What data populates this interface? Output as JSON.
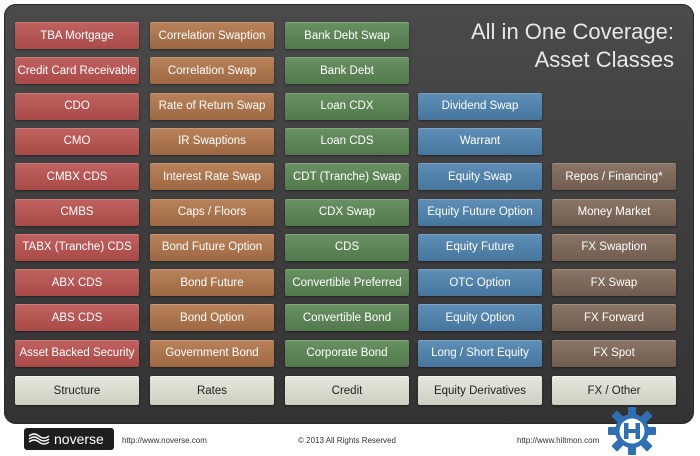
{
  "title": {
    "line1": "All in One Coverage:",
    "line2": "Asset Classes"
  },
  "columns": [
    {
      "key": "structure",
      "label": "Structure",
      "items": [
        "TBA Mortgage",
        "Credit Card Receivable",
        "CDO",
        "CMO",
        "CMBX CDS",
        "CMBS",
        "TABX (Tranche) CDS",
        "ABX CDS",
        "ABS CDS",
        "Asset Backed Security"
      ]
    },
    {
      "key": "rates",
      "label": "Rates",
      "items": [
        "Correlation Swaption",
        "Correlation Swap",
        "Rate of Return Swap",
        "IR Swaptions",
        "Interest Rate Swap",
        "Caps / Floors",
        "Bond Future Option",
        "Bond Future",
        "Bond Option",
        "Government Bond"
      ]
    },
    {
      "key": "credit",
      "label": "Credit",
      "items": [
        "Bank Debt Swap",
        "Bank Debt",
        "Loan CDX",
        "Loan CDS",
        "CDT (Tranche) Swap",
        "CDX Swap",
        "CDS",
        "Convertible Preferred",
        "Convertible Bond",
        "Corporate Bond"
      ]
    },
    {
      "key": "equity",
      "label": "Equity Derivatives",
      "items": [
        "Dividend Swap",
        "Warrant",
        "Equity Swap",
        "Equity Future Option",
        "Equity Future",
        "OTC Option",
        "Equity Option",
        "Long / Short Equity"
      ]
    },
    {
      "key": "fx",
      "label": "FX / Other",
      "items": [
        "Repos / Financing*",
        "Money Market",
        "FX Swaption",
        "FX Swap",
        "FX Forward",
        "FX Spot"
      ]
    }
  ],
  "footer": {
    "logo_name": "noverse",
    "logo_icon": "noverse-wave-icon",
    "left_url": "http://www.noverse.com",
    "copyright": "© 2013 All Rights Reserved",
    "right_url": "http://www.hiltmon.com",
    "right_logo_icon": "hiltmon-gear-h-icon"
  },
  "colors": {
    "structure": "#b3524f",
    "rates": "#a87250",
    "credit": "#5c8456",
    "equity": "#5081a9",
    "fx": "#7b6759",
    "panel": "#424242",
    "footer_tab": "#dcdbd0"
  }
}
